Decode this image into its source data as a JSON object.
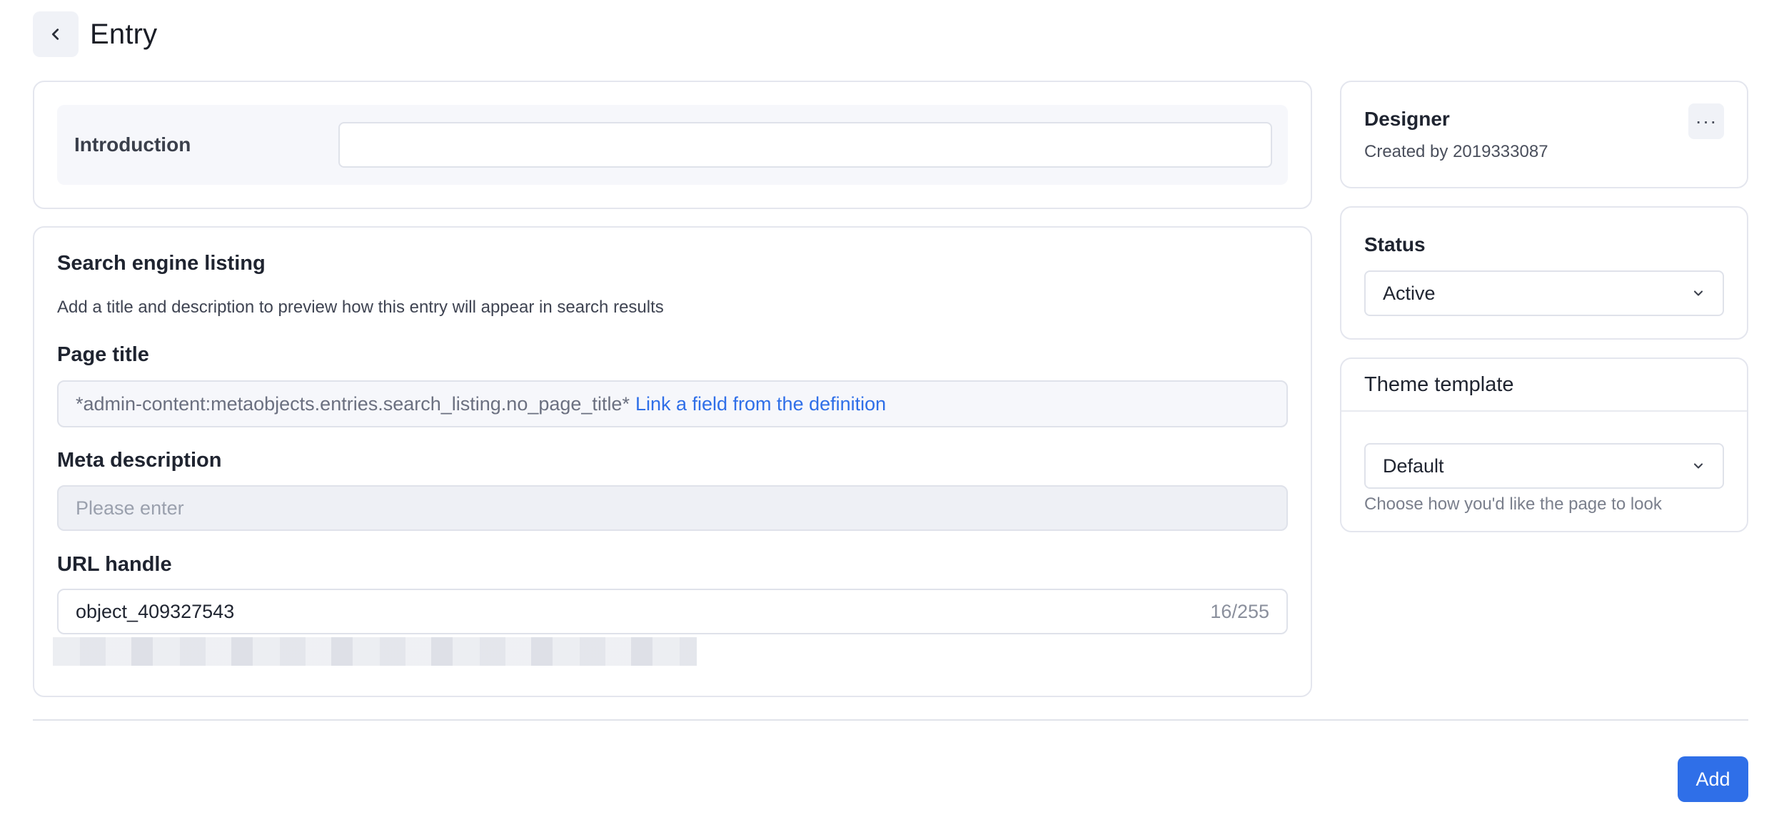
{
  "header": {
    "title": "Entry",
    "back_icon": "chevron-left-icon"
  },
  "introduction": {
    "label": "Introduction",
    "value": ""
  },
  "seo": {
    "title": "Search engine listing",
    "description": "Add a title and description to preview how this entry will appear in search results",
    "page_title": {
      "label": "Page title",
      "value": "*admin-content:metaobjects.entries.search_listing.no_page_title*",
      "link_text": "Link a field from the definition"
    },
    "meta_description": {
      "label": "Meta description",
      "placeholder": "Please enter"
    },
    "url_handle": {
      "label": "URL handle",
      "value": "object_409327543",
      "counter": "16/255"
    }
  },
  "designer": {
    "title": "Designer",
    "subtitle": "Created by 2019333087",
    "more_icon": "more-horizontal-icon",
    "more_label": "···"
  },
  "status": {
    "title": "Status",
    "selected": "Active"
  },
  "theme_template": {
    "title": "Theme template",
    "selected": "Default",
    "help": "Choose how you'd like the page to look"
  },
  "footer": {
    "add_label": "Add"
  },
  "colors": {
    "accent": "#2f6fe8",
    "border": "#dfe2ea",
    "muted_bg": "#f6f7fb"
  }
}
